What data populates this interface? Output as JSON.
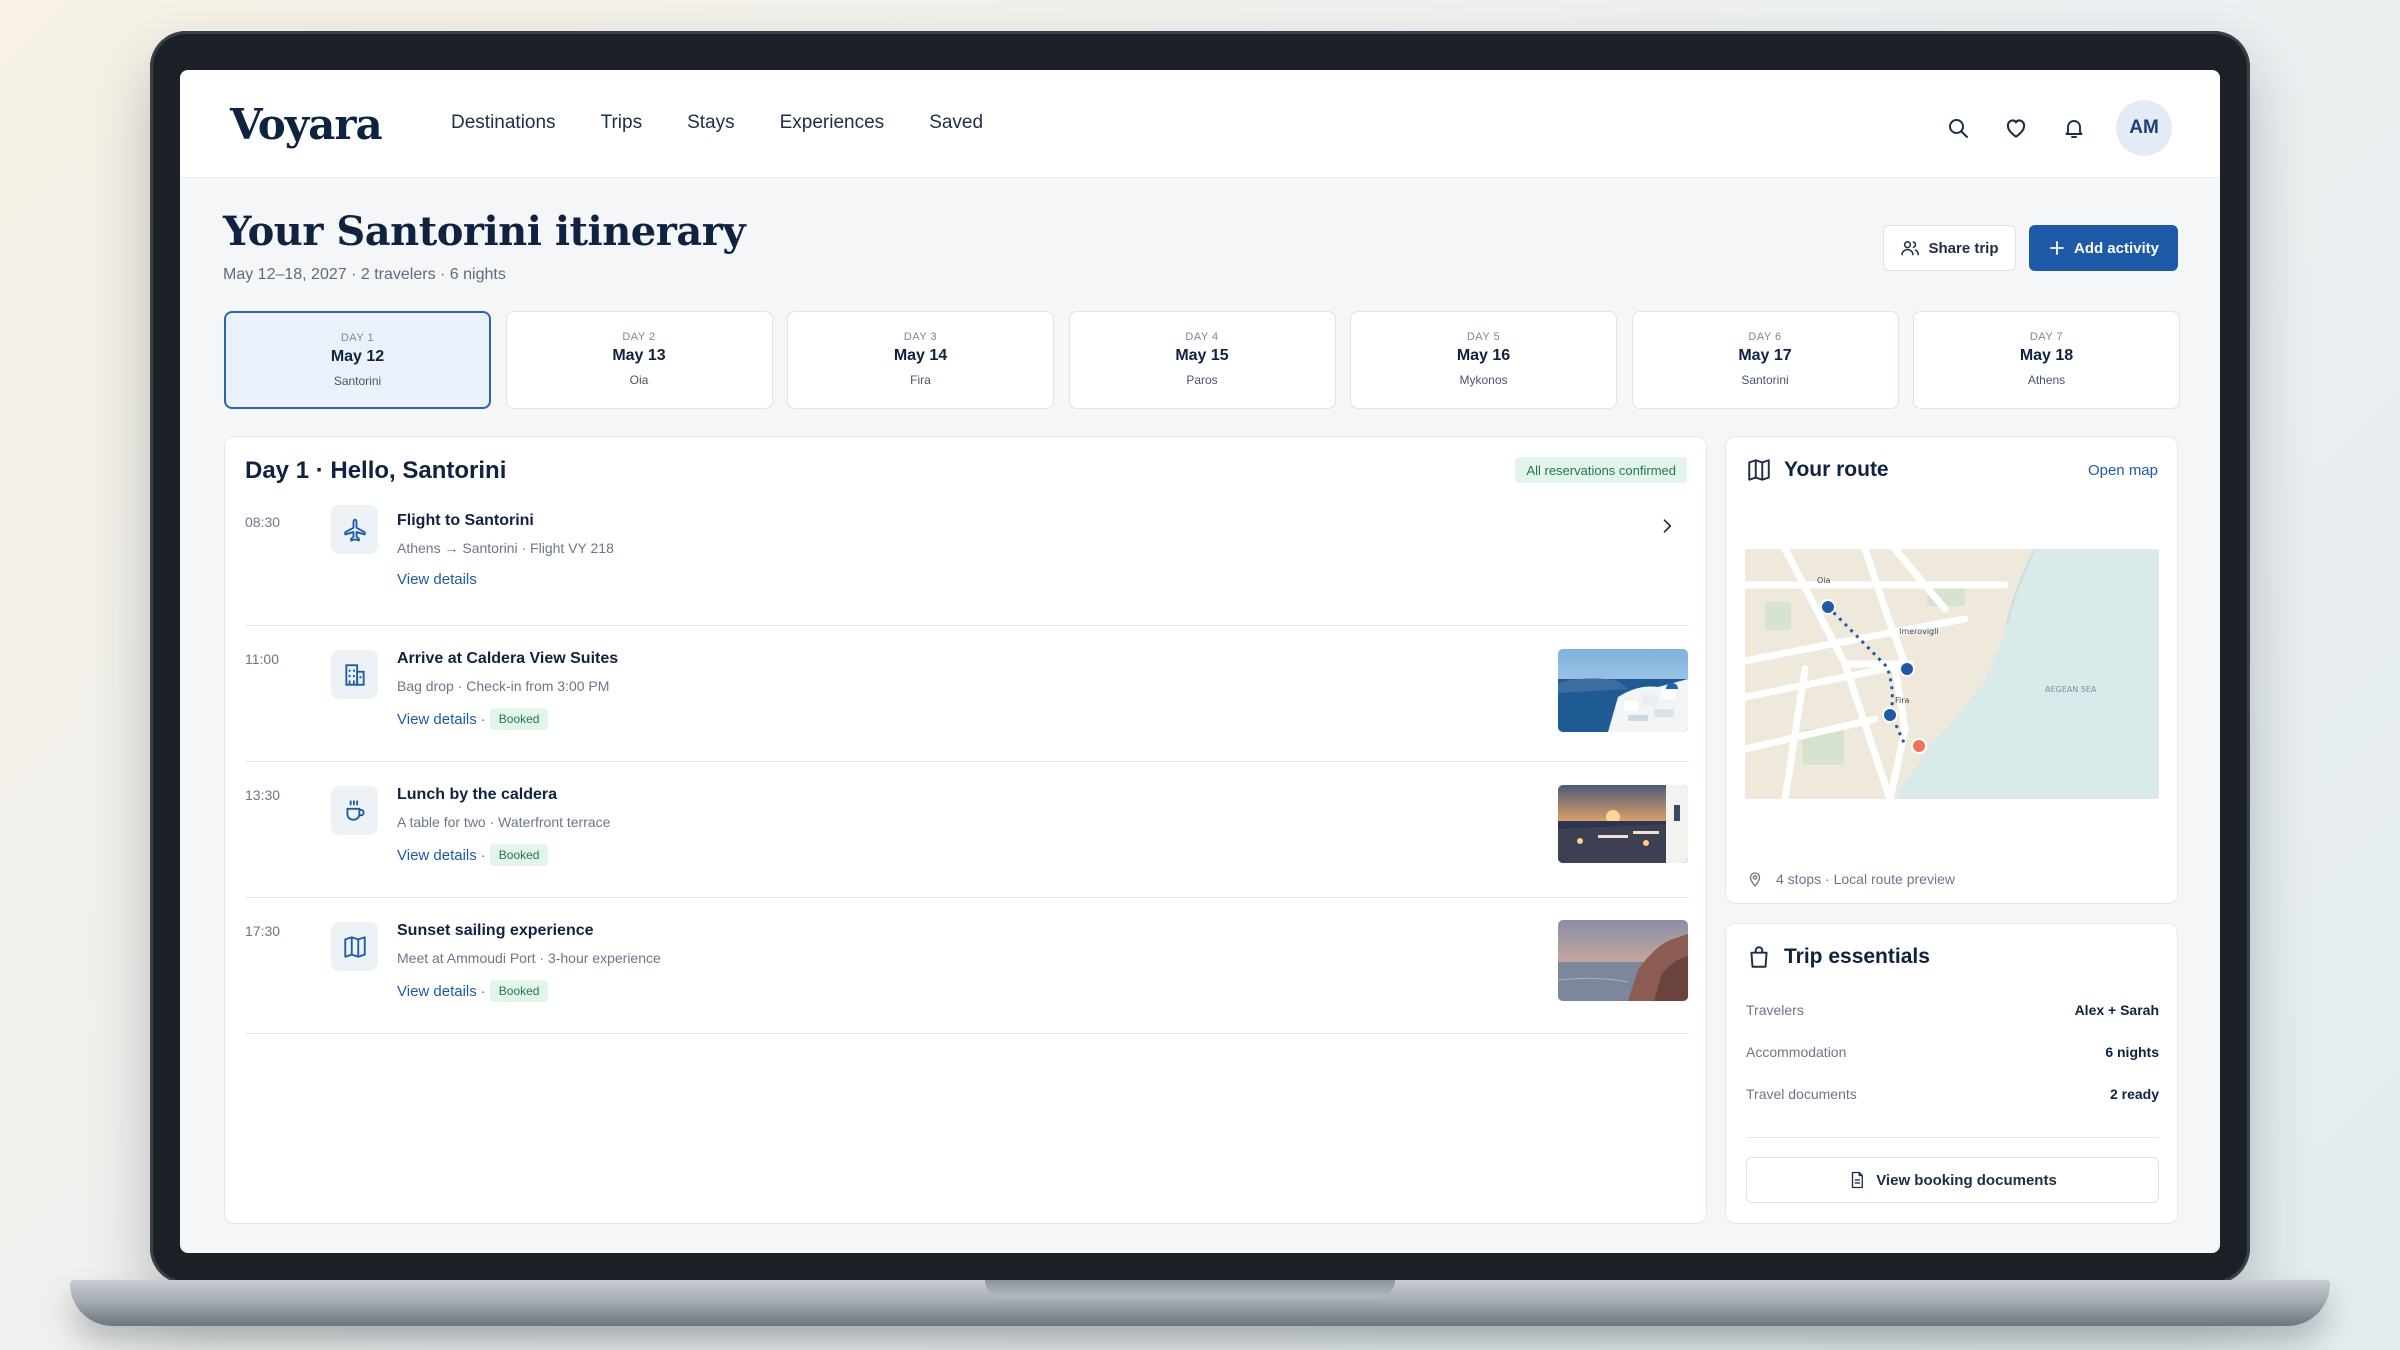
{
  "brand": {
    "logo": "Voyara",
    "accent": "#1f5aa6",
    "ink": "#0f2340"
  },
  "nav": {
    "links": [
      "Destinations",
      "Trips",
      "Stays",
      "Experiences",
      "Saved"
    ],
    "icons": [
      "search-icon",
      "heart-icon",
      "bell-icon"
    ],
    "avatar_initials": "AM"
  },
  "header": {
    "title": "Your Santorini itinerary",
    "subtitle": "May 12–18, 2027 · 2 travelers · 6 nights",
    "share_label": "Share trip",
    "add_label": "Add activity"
  },
  "days": [
    {
      "label": "DAY 1",
      "date": "May 12",
      "place": "Santorini",
      "active": true
    },
    {
      "label": "DAY 2",
      "date": "May 13",
      "place": "Oia"
    },
    {
      "label": "DAY 3",
      "date": "May 14",
      "place": "Fira"
    },
    {
      "label": "DAY 4",
      "date": "May 15",
      "place": "Paros"
    },
    {
      "label": "DAY 5",
      "date": "May 16",
      "place": "Mykonos"
    },
    {
      "label": "DAY 6",
      "date": "May 17",
      "place": "Santorini"
    },
    {
      "label": "DAY 7",
      "date": "May 18",
      "place": "Athens"
    }
  ],
  "itinerary": {
    "title": "Day 1 · Hello, Santorini",
    "status": "All reservations confirmed",
    "activities": [
      {
        "time": "08:30",
        "icon": "plane-icon",
        "title": "Flight to Santorini",
        "subtitle": "Athens → Santorini · Flight VY 218",
        "link": "View details"
      },
      {
        "time": "11:00",
        "icon": "building-icon",
        "title": "Arrive at Caldera View Suites",
        "subtitle": "Bag drop · Check-in from 3:00 PM",
        "link": "View details",
        "sep": " ·",
        "badge": "Booked"
      },
      {
        "time": "13:30",
        "icon": "coffee-icon",
        "title": "Lunch by the caldera",
        "subtitle": "A table for two · Waterfront terrace",
        "link": "View details",
        "sep": " ·",
        "badge": "Booked"
      },
      {
        "time": "17:30",
        "icon": "map-icon",
        "title": "Sunset sailing experience",
        "subtitle": "Meet at Ammoudi Port · 3-hour experience",
        "link": "View details",
        "sep": " ·",
        "badge": "Booked"
      }
    ]
  },
  "route": {
    "title": "Your route",
    "open_map": "Open map",
    "map_labels": {
      "oia": "Oia",
      "imerovigli": "Imerovigli",
      "fira": "Fira",
      "sea": "AEGEAN SEA"
    },
    "footer": "4 stops · Local route preview"
  },
  "essentials": {
    "title": "Trip essentials",
    "rows": [
      {
        "key": "Travelers",
        "value": "Alex + Sarah"
      },
      {
        "key": "Accommodation",
        "value": "6 nights"
      },
      {
        "key": "Travel documents",
        "value": "2 ready"
      }
    ],
    "docs_button": "View booking documents"
  }
}
